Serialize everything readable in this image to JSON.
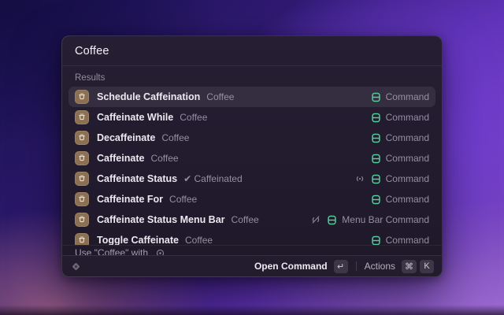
{
  "search": {
    "value": "Coffee"
  },
  "section_label": "Results",
  "results": [
    {
      "title": "Schedule Caffeination",
      "subtitle": "Coffee",
      "accessory": "Command",
      "extra": null,
      "selected": true
    },
    {
      "title": "Caffeinate While",
      "subtitle": "Coffee",
      "accessory": "Command",
      "extra": null,
      "selected": false
    },
    {
      "title": "Decaffeinate",
      "subtitle": "Coffee",
      "accessory": "Command",
      "extra": null,
      "selected": false
    },
    {
      "title": "Caffeinate",
      "subtitle": "Coffee",
      "accessory": "Command",
      "extra": null,
      "selected": false
    },
    {
      "title": "Caffeinate Status",
      "subtitle": "✔ Caffeinated",
      "accessory": "Command",
      "extra": "signal",
      "selected": false
    },
    {
      "title": "Caffeinate For",
      "subtitle": "Coffee",
      "accessory": "Command",
      "extra": null,
      "selected": false
    },
    {
      "title": "Caffeinate Status Menu Bar",
      "subtitle": "Coffee",
      "accessory": "Menu Bar Command",
      "extra": "signal-slash",
      "selected": false
    },
    {
      "title": "Toggle Caffeinate",
      "subtitle": "Coffee",
      "accessory": "Command",
      "extra": null,
      "selected": false
    }
  ],
  "use_with": {
    "label": "Use \"Coffee\" with"
  },
  "footer": {
    "primary": "Open Command",
    "primary_key": "↵",
    "secondary": "Actions",
    "keys": [
      "⌘",
      "K"
    ]
  },
  "colors": {
    "accent_green": "#52ce9b",
    "extension_icon_bg": "#8c7053",
    "muted_icon": "#8b8494"
  }
}
